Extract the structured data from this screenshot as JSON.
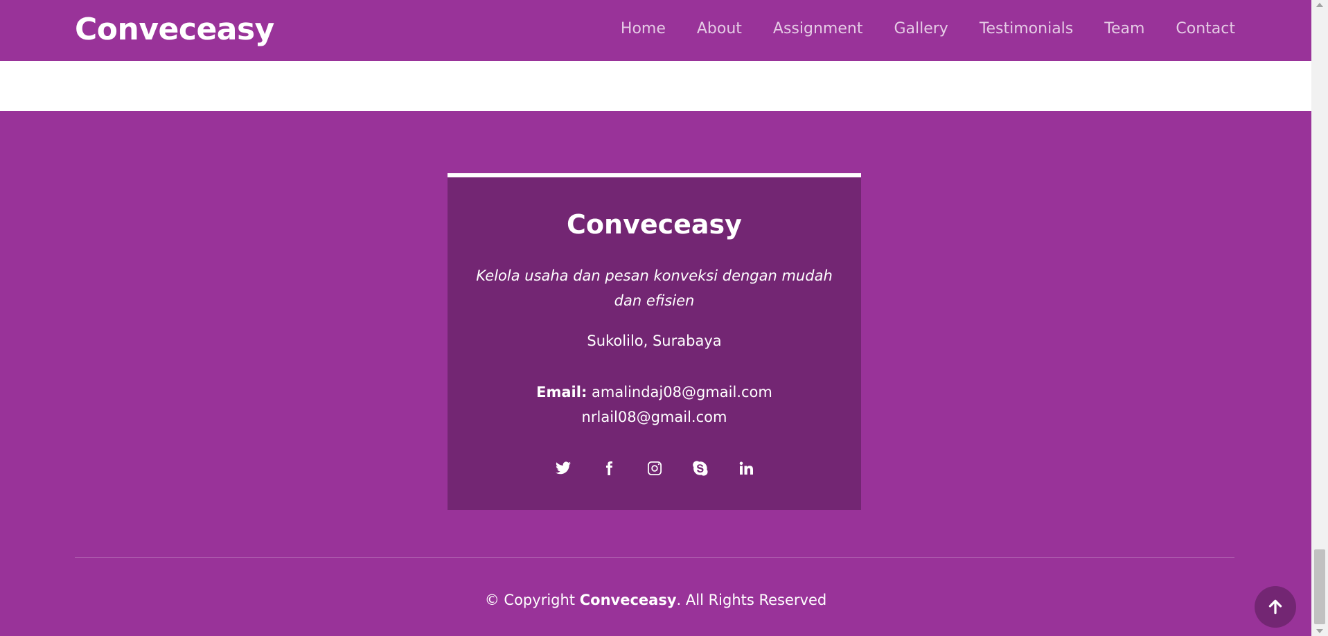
{
  "brand": "Conveceasy",
  "nav": [
    "Home",
    "About",
    "Assignment",
    "Gallery",
    "Testimonials",
    "Team",
    "Contact"
  ],
  "footer": {
    "title": "Conveceasy",
    "tagline": "Kelola usaha dan pesan konveksi dengan mudah dan efisien",
    "address": "Sukolilo, Surabaya",
    "email_label": "Email:",
    "email_primary": "amalindaj08@gmail.com",
    "email_secondary": "nrlail08@gmail.com",
    "socials": [
      "twitter-icon",
      "facebook-icon",
      "instagram-icon",
      "skype-icon",
      "linkedin-icon"
    ],
    "copyright_prefix": "© Copyright",
    "copyright_brand": "Conveceasy",
    "copyright_suffix": ". All Rights Reserved"
  },
  "back_to_top_icon": "arrow-up-icon",
  "colors": {
    "primary": "#993399",
    "card": "#732673",
    "white": "#ffffff"
  }
}
